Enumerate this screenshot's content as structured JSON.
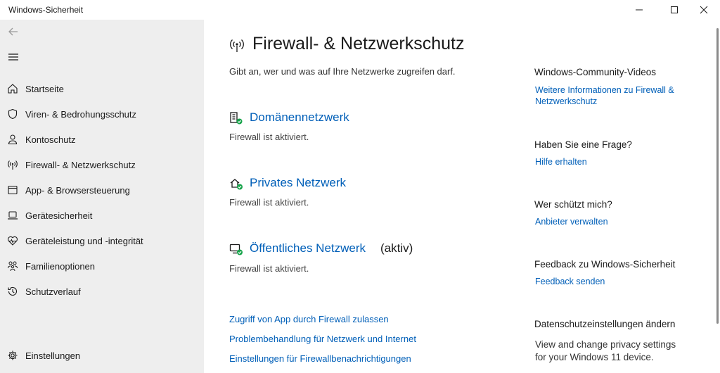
{
  "window": {
    "title": "Windows-Sicherheit",
    "controls": [
      "minimize-icon",
      "maximize-icon",
      "close-icon"
    ]
  },
  "sidebar": {
    "back_icon": "arrow-left-icon",
    "menu_icon": "hamburger-menu-icon",
    "items": [
      {
        "label": "Startseite",
        "icon": "home-icon"
      },
      {
        "label": "Viren- & Bedrohungsschutz",
        "icon": "shield-icon"
      },
      {
        "label": "Kontoschutz",
        "icon": "person-icon"
      },
      {
        "label": "Firewall- & Netzwerkschutz",
        "icon": "antenna-icon"
      },
      {
        "label": "App- & Browsersteuerung",
        "icon": "app-window-icon"
      },
      {
        "label": "Gerätesicherheit",
        "icon": "laptop-icon"
      },
      {
        "label": "Geräteleistung und -integrität",
        "icon": "heart-pulse-icon"
      },
      {
        "label": "Familienoptionen",
        "icon": "family-icon"
      },
      {
        "label": "Schutzverlauf",
        "icon": "history-icon"
      }
    ],
    "settings": {
      "label": "Einstellungen",
      "icon": "gear-icon"
    }
  },
  "main": {
    "title": "Firewall- & Netzwerkschutz",
    "title_icon": "antenna-icon",
    "description": "Gibt an, wer und was auf Ihre Netzwerke zugreifen darf.",
    "networks": [
      {
        "name": "Domänennetzwerk",
        "status": "Firewall ist aktiviert.",
        "active": "",
        "icon": "domain-network-icon"
      },
      {
        "name": "Privates Netzwerk",
        "status": "Firewall ist aktiviert.",
        "active": "",
        "icon": "private-network-icon"
      },
      {
        "name": "Öffentliches Netzwerk",
        "status": "Firewall ist aktiviert.",
        "active": "(aktiv)",
        "icon": "public-network-icon"
      }
    ],
    "links": [
      "Zugriff von App durch Firewall zulassen",
      "Problembehandlung für Netzwerk und Internet",
      "Einstellungen für Firewallbenachrichtigungen"
    ]
  },
  "side_panel": {
    "community": {
      "heading": "Windows-Community-Videos",
      "link_line1": "Weitere Informationen zu Firewall &",
      "link_line2": "Netzwerkschutz"
    },
    "question": {
      "heading": "Haben Sie eine Frage?",
      "link": "Hilfe erhalten"
    },
    "protector": {
      "heading": "Wer schützt mich?",
      "link": "Anbieter verwalten"
    },
    "feedback": {
      "heading": "Feedback zu Windows-Sicherheit",
      "link": "Feedback senden"
    },
    "privacy": {
      "heading": "Datenschutzeinstellungen ändern",
      "text_line1": "View and change privacy settings",
      "text_line2": "for your Windows 11 device."
    }
  },
  "colors": {
    "link": "#005fb8",
    "sidebar_bg": "#eeeeee",
    "status_ok": "#16a34a"
  }
}
